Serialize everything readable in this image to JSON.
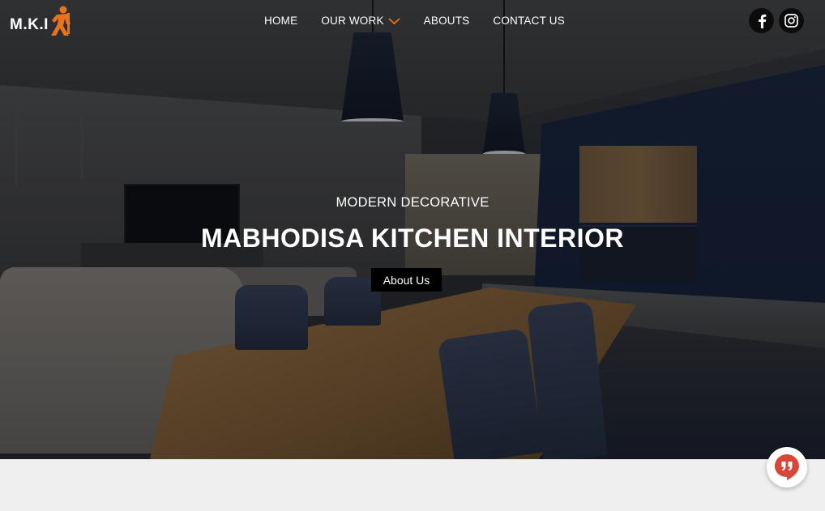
{
  "brand": {
    "logo_text": "M.K.I"
  },
  "nav": {
    "items": [
      {
        "label": "HOME"
      },
      {
        "label": "OUR WORK",
        "has_dropdown": true
      },
      {
        "label": "ABOUTS"
      },
      {
        "label": "CONTACT US"
      }
    ]
  },
  "social": {
    "facebook": "facebook-icon",
    "instagram": "instagram-icon"
  },
  "hero": {
    "subtitle": "MODERN DECORATIVE",
    "title": "MABHODISA KITCHEN INTERIOR",
    "button_label": "About Us"
  },
  "chat": {
    "icon": "chat-quote-icon"
  },
  "colors": {
    "accent": "#e8731c",
    "chat_red": "#d8463a",
    "dark": "#000000"
  }
}
